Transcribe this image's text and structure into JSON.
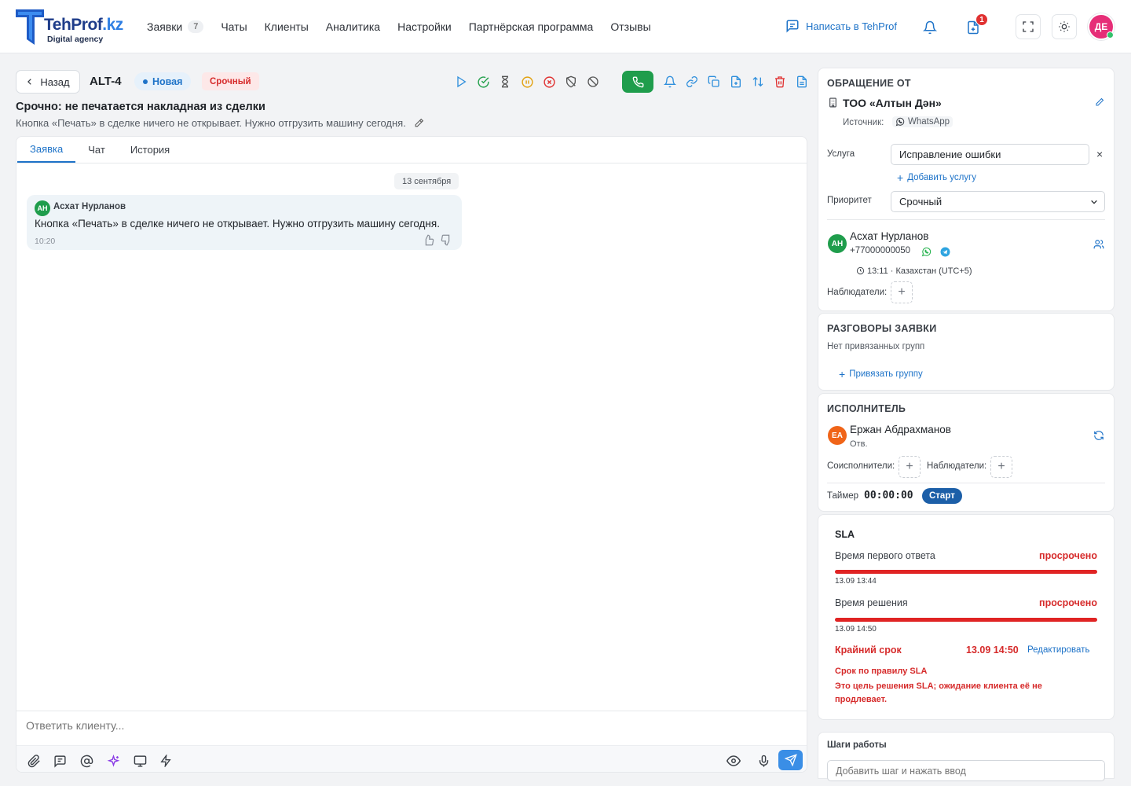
{
  "brand": {
    "name_main": "TehProf",
    "name_suffix": ".kz",
    "tagline": "Digital agency"
  },
  "nav": {
    "items": [
      {
        "label": "Заявки",
        "count": "7"
      },
      {
        "label": "Чаты"
      },
      {
        "label": "Клиенты"
      },
      {
        "label": "Аналитика"
      },
      {
        "label": "Настройки"
      },
      {
        "label": "Партнёрская программа"
      },
      {
        "label": "Отзывы"
      }
    ],
    "write_label": "Написать в TehProf",
    "notif_badge": "1",
    "user_initials": "ДЕ"
  },
  "ticket": {
    "back_label": "Назад",
    "id": "ALT-4",
    "status": "Новая",
    "priority_badge": "Срочный",
    "title": "Срочно: не печатается накладная из сделки",
    "description": "Кнопка «Печать» в сделке ничего не открывает. Нужно отгрузить машину сегодня."
  },
  "tabs": [
    "Заявка",
    "Чат",
    "История"
  ],
  "chat": {
    "date": "13 сентября",
    "message": {
      "initials": "АН",
      "author": "Асхат Нурланов",
      "text": "Кнопка «Печать» в сделке ничего не открывает. Нужно отгрузить машину сегодня.",
      "time": "10:20"
    }
  },
  "composer": {
    "placeholder": "Ответить клиенту..."
  },
  "request_card": {
    "title": "ОБРАЩЕНИЕ ОТ",
    "company": "ТОО «Алтын Дән»",
    "source_label": "Источник:",
    "source": "WhatsApp",
    "service_label": "Услуга",
    "service_value": "Исправление ошибки",
    "add_service": "Добавить услугу",
    "priority_label": "Приоритет",
    "priority_value": "Срочный",
    "contact_initials": "АН",
    "contact_name": "Асхат Нурланов",
    "contact_phone": "+77000000050",
    "contact_time": "13:11 · Казахстан (UTC+5)",
    "watchers_label": "Наблюдатели:"
  },
  "conversations_card": {
    "title": "РАЗГОВОРЫ ЗАЯВКИ",
    "empty_text": "Нет привязанных групп",
    "link_label": "Привязать группу"
  },
  "assignee_card": {
    "title": "ИСПОЛНИТЕЛЬ",
    "initials": "ЕА",
    "name": "Ержан Абдрахманов",
    "role": "Отв.",
    "coexec_label": "Соисполнители:",
    "watchers_label": "Наблюдатели:",
    "timer_label": "Таймер",
    "timer_value": "00:00:00",
    "start_label": "Старт"
  },
  "sla_card": {
    "title": "SLA",
    "first_response_label": "Время первого ответа",
    "first_response_status": "просрочено",
    "first_response_date": "13.09 13:44",
    "resolution_label": "Время решения",
    "resolution_status": "просрочено",
    "resolution_date": "13.09 14:50",
    "deadline_label": "Крайний срок",
    "deadline_value": "13.09 14:50",
    "edit_label": "Редактировать",
    "rule_text": "Срок по правилу SLA",
    "note_text_1": "Это цель решения SLA; ожидание клиента её не",
    "note_text_2": "продлевает."
  },
  "steps_card": {
    "title": "Шаги работы",
    "placeholder": "Добавить шаг и нажать ввод"
  },
  "colors": {
    "accent": "#1e73c8",
    "call_green": "#1f9d4c",
    "danger": "#d62b2b",
    "avatar_pink": "#e62e77",
    "avatar_orange": "#f06418"
  }
}
